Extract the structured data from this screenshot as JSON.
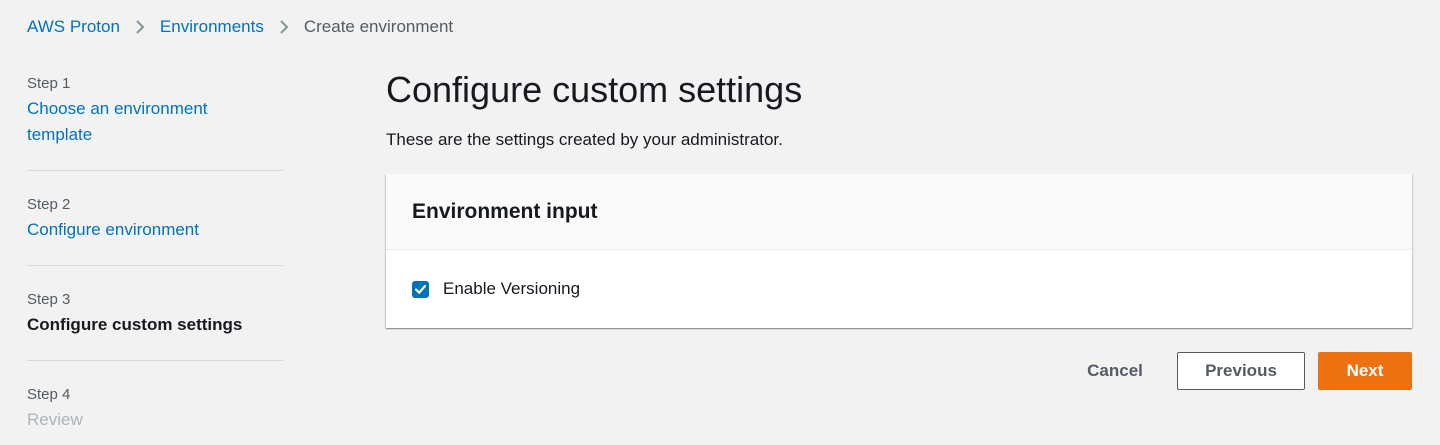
{
  "breadcrumb": {
    "items": [
      {
        "label": "AWS Proton"
      },
      {
        "label": "Environments"
      },
      {
        "label": "Create environment"
      }
    ]
  },
  "steps": [
    {
      "number": "Step 1",
      "title": "Choose an environment template",
      "state": "link"
    },
    {
      "number": "Step 2",
      "title": "Configure environment",
      "state": "link"
    },
    {
      "number": "Step 3",
      "title": "Configure custom settings",
      "state": "active"
    },
    {
      "number": "Step 4",
      "title": "Review",
      "state": "disabled"
    }
  ],
  "main": {
    "title": "Configure custom settings",
    "description": "These are the settings created by your administrator.",
    "container": {
      "title": "Environment input",
      "checkbox": {
        "label": "Enable Versioning",
        "checked": true
      }
    }
  },
  "actions": {
    "cancel_label": "Cancel",
    "previous_label": "Previous",
    "next_label": "Next"
  },
  "colors": {
    "link": "#0073bb",
    "primary": "#ec7211",
    "background": "#f2f2f2",
    "text": "#16191f",
    "muted": "#545b64",
    "disabled": "#aab7b8"
  },
  "icons": {
    "breadcrumb_separator": "chevron-right-icon",
    "checkbox": "checkmark-icon"
  }
}
